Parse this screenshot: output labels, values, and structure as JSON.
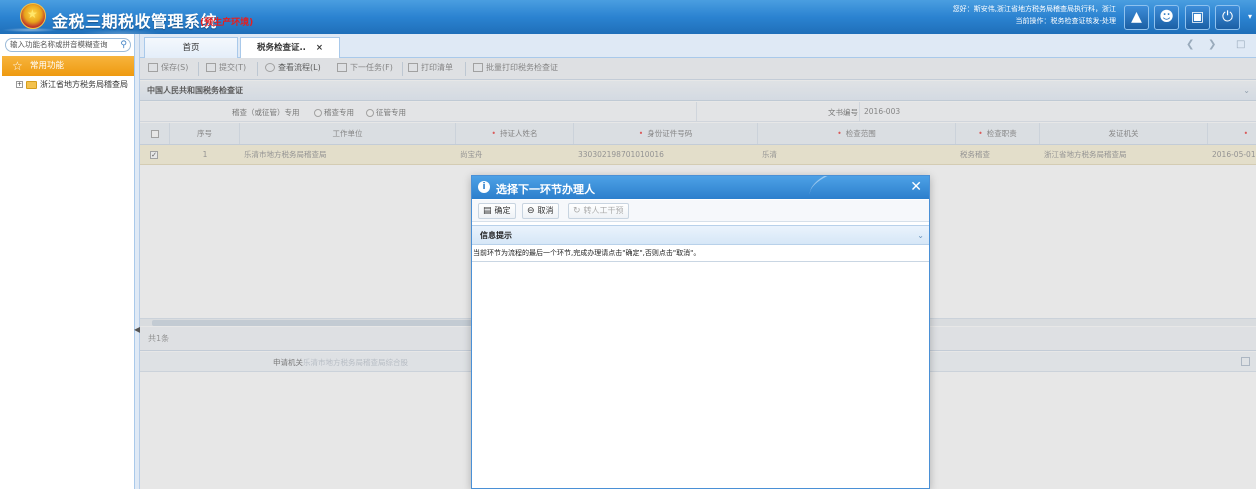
{
  "header": {
    "app_title": "金税三期税收管理系统",
    "env_tag": "(预生产环境)",
    "user_line1": "您好：斯安伟,浙江省地方税务局稽查局执行科，浙江",
    "user_line2": "当前操作：税务检查证核发-处理",
    "icons": [
      "bell-icon",
      "users-icon",
      "chat-icon",
      "power-icon"
    ]
  },
  "sidebar": {
    "search_placeholder": "输入功能名称或拼音模糊查询",
    "favorites_label": "常用功能",
    "tree_item": "浙江省地方税务局稽查局"
  },
  "tabs": [
    {
      "label": "首页"
    },
    {
      "label": "税务检查证..",
      "close": "×"
    }
  ],
  "toolbar": {
    "save": "保存(S)",
    "submit": "提交(T)",
    "view_flow": "查看流程(L)",
    "next_task": "下一任务(F)",
    "print_list": "打印清单",
    "batch_print": "批量打印税务检查证"
  },
  "section": {
    "title": "中国人民共和国税务检查证",
    "type_label": "稽查（或征管）专用",
    "radio_jicha": "稽查专用",
    "radio_zhengguan": "征管专用",
    "doc_no_label": "文书编号",
    "doc_no_value": "2016-003"
  },
  "grid": {
    "columns": [
      "序号",
      "工作单位",
      "持证人姓名",
      "身份证件号码",
      "检查范围",
      "检查职责",
      "发证机关"
    ],
    "required_flags": [
      false,
      false,
      true,
      true,
      true,
      true,
      false
    ],
    "rows": [
      {
        "checked": "✓",
        "seq": "1",
        "unit": "乐清市地方税务局稽查局",
        "holder": "尚宝舟",
        "id_number": "330302198701010016",
        "scope": "乐清",
        "duty": "税务稽查",
        "issuer": "浙江省地方税务局稽查局",
        "date": "2016-05-01"
      }
    ],
    "footer": "共1条"
  },
  "apply": {
    "label": "申请机关",
    "value": "乐清市地方税务局稽查局综合股"
  },
  "dialog": {
    "title": "选择下一环节办理人",
    "confirm": "确定",
    "cancel": "取消",
    "transfer": "转人工干预",
    "section_title": "信息提示",
    "message": "当前环节为流程的最后一个环节,完成办理请点击\"确定\",否则点击\"取消\"。"
  },
  "colors": {
    "header_blue": "#2b83d1",
    "favorites_orange": "#f0a020",
    "env_red": "#e61d1d",
    "selected_row": "#fbf4dc"
  }
}
